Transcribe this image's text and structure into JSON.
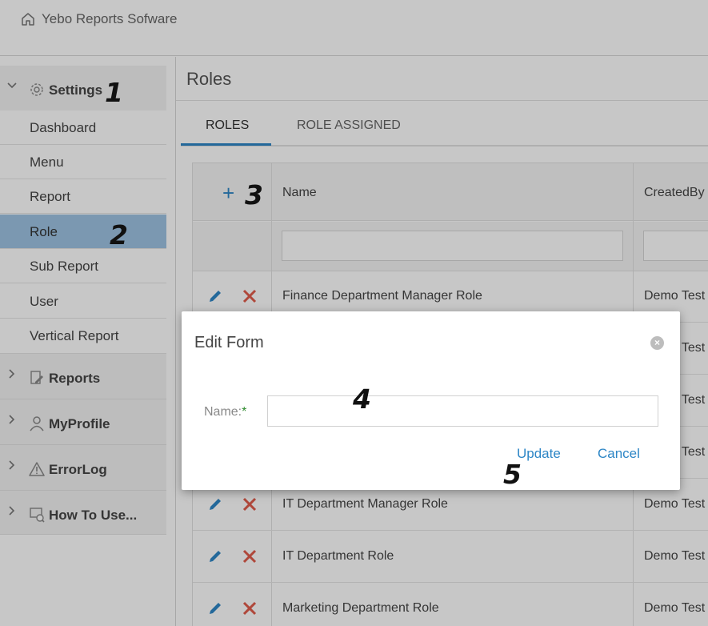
{
  "header": {
    "app_title": "Yebo Reports Sofware",
    "icon": "home-icon"
  },
  "sidebar": {
    "settings": {
      "label": "Settings",
      "icon": "gear-icon"
    },
    "items": [
      {
        "label": "Dashboard"
      },
      {
        "label": "Menu"
      },
      {
        "label": "Report"
      },
      {
        "label": "Role"
      },
      {
        "label": "Sub Report"
      },
      {
        "label": "User"
      },
      {
        "label": "Vertical Report"
      }
    ],
    "groups": [
      {
        "label": "Reports",
        "icon": "report-edit-icon"
      },
      {
        "label": "MyProfile",
        "icon": "user-icon"
      },
      {
        "label": "ErrorLog",
        "icon": "warning-icon"
      },
      {
        "label": "How To Use...",
        "icon": "help-monitor-icon"
      }
    ]
  },
  "page": {
    "title": "Roles"
  },
  "tabs": [
    {
      "label": "ROLES"
    },
    {
      "label": "ROLE ASSIGNED"
    }
  ],
  "grid": {
    "add_symbol": "+",
    "columns": {
      "name": "Name",
      "created_by": "CreatedBy"
    },
    "rows": [
      {
        "name": "Finance Department Manager Role",
        "created_by": "Demo Test"
      },
      {
        "name": "",
        "created_by": "Demo Test"
      },
      {
        "name": "",
        "created_by": "Demo Test"
      },
      {
        "name": "",
        "created_by": "Demo Test"
      },
      {
        "name": "IT Department Manager Role",
        "created_by": "Demo Test"
      },
      {
        "name": "IT Department Role",
        "created_by": "Demo Test"
      },
      {
        "name": "Marketing Department Role",
        "created_by": "Demo Test"
      }
    ]
  },
  "modal": {
    "title": "Edit Form",
    "name_label": "Name:",
    "required_mark": "*",
    "name_value": "",
    "update_label": "Update",
    "cancel_label": "Cancel"
  },
  "markers": [
    "1",
    "2",
    "3",
    "4",
    "5"
  ],
  "colors": {
    "accent": "#2d86c6",
    "active_item": "#9ec3e3",
    "delete": "#e05b4b",
    "required": "#2e8b2e"
  }
}
